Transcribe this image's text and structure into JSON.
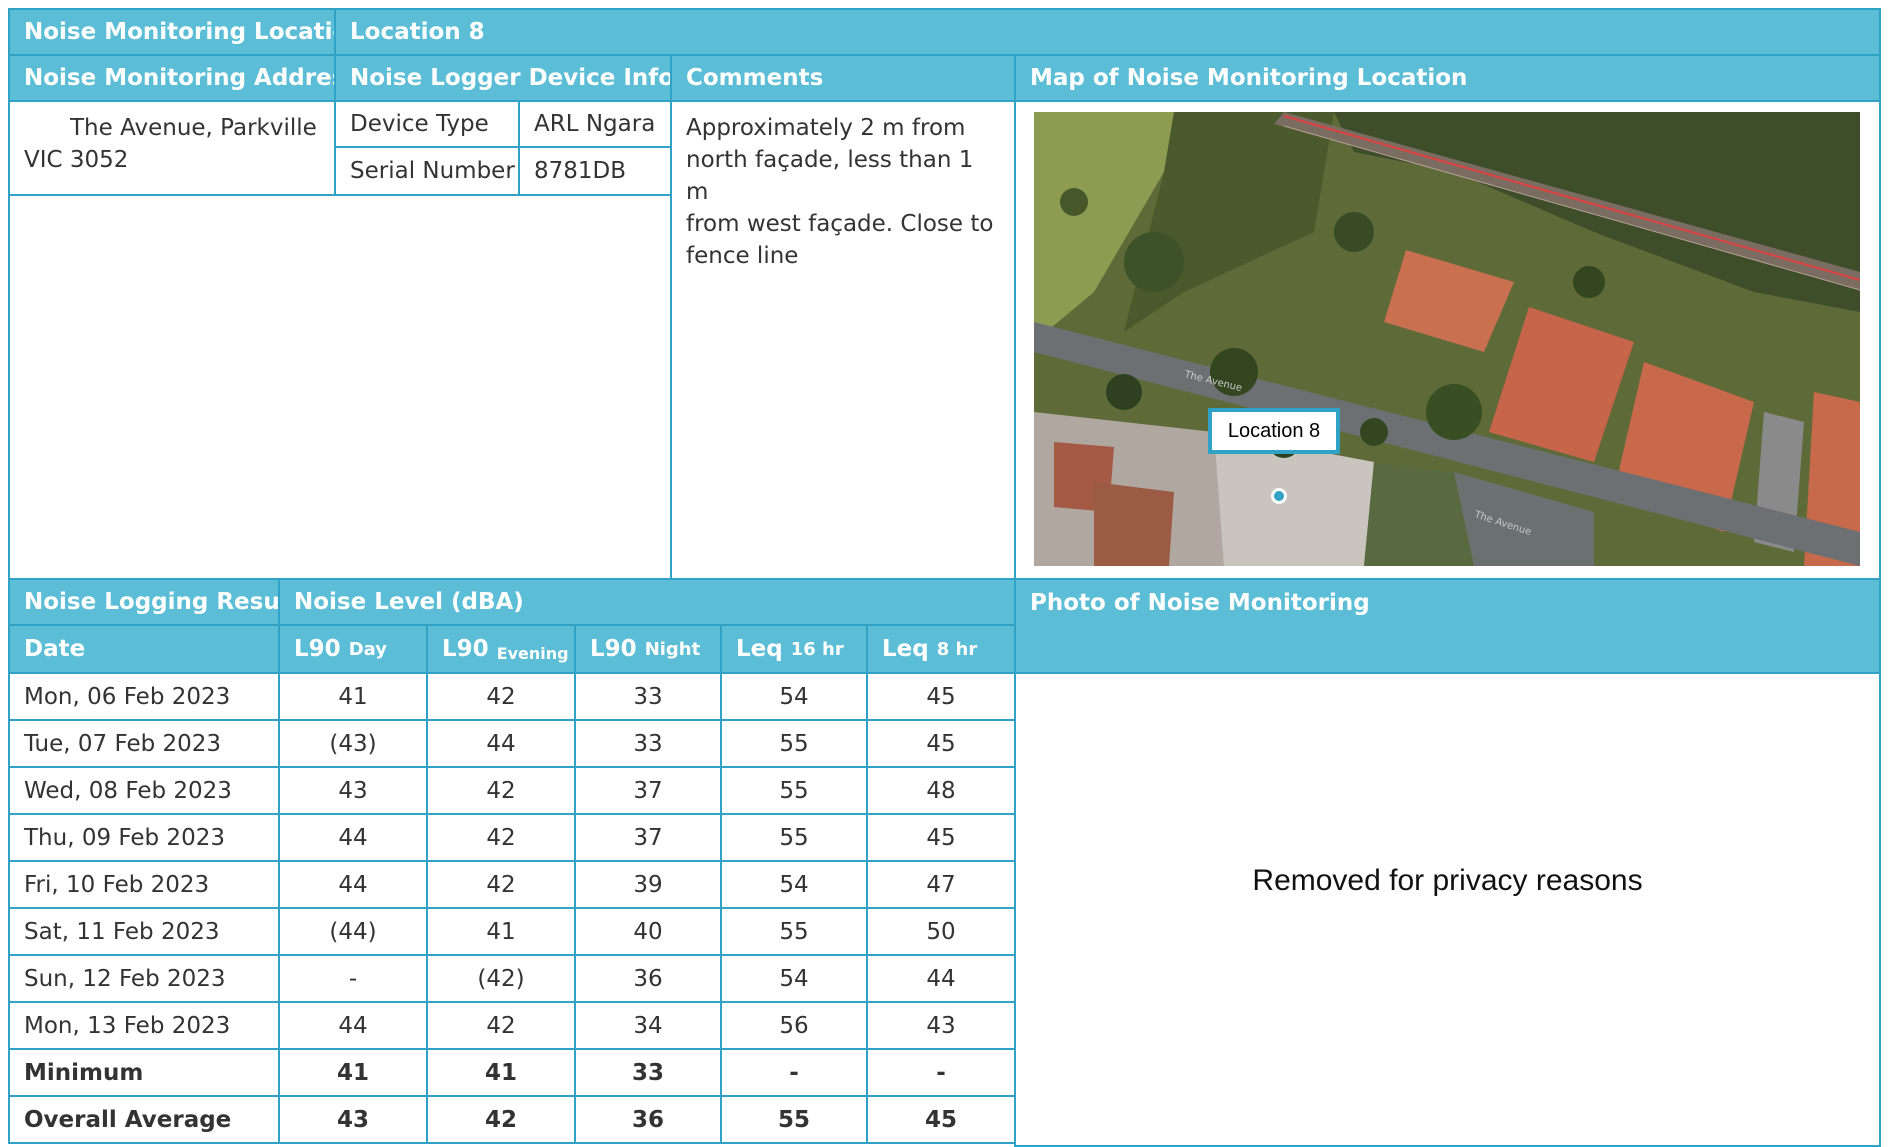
{
  "header": {
    "location_label": "Noise Monitoring Location",
    "location_value": "Location 8",
    "address_label": "Noise Monitoring Address",
    "device_label": "Noise Logger Device Info",
    "comments_label": "Comments",
    "map_label": "Map of Noise Monitoring Location"
  },
  "address": {
    "line1": "The Avenue, Parkville",
    "line2": "VIC 3052"
  },
  "device": {
    "type_label": "Device Type",
    "type_value": "ARL Ngara",
    "serial_label": "Serial Number",
    "serial_value": "8781DB"
  },
  "comments": {
    "line1": "Approximately 2 m from",
    "line2": "north façade, less than 1 m",
    "line3": "from west façade. Close to",
    "line4": "fence line"
  },
  "map": {
    "marker_label": "Location 8",
    "road_labels": [
      "The Avenue",
      "The Avenue"
    ]
  },
  "results": {
    "title": "Noise Logging Results",
    "level_title": "Noise Level (dBA)",
    "photo_title": "Photo of Noise Monitoring",
    "photo_placeholder": "Removed for privacy reasons",
    "columns": {
      "date": "Date",
      "l90_day_main": "L90",
      "l90_day_sub": "Day",
      "l90_eve_main": "L90",
      "l90_eve_sub": "Evening",
      "l90_night_main": "L90",
      "l90_night_sub": "Night",
      "leq16_main": "Leq",
      "leq16_sub": "16 hr",
      "leq8_main": "Leq",
      "leq8_sub": "8 hr"
    },
    "rows": [
      [
        "Mon, 06 Feb 2023",
        "41",
        "42",
        "33",
        "54",
        "45"
      ],
      [
        "Tue, 07 Feb 2023",
        "(43)",
        "44",
        "33",
        "55",
        "45"
      ],
      [
        "Wed, 08 Feb 2023",
        "43",
        "42",
        "37",
        "55",
        "48"
      ],
      [
        "Thu, 09 Feb 2023",
        "44",
        "42",
        "37",
        "55",
        "45"
      ],
      [
        "Fri, 10 Feb 2023",
        "44",
        "42",
        "39",
        "54",
        "47"
      ],
      [
        "Sat, 11 Feb 2023",
        "(44)",
        "41",
        "40",
        "55",
        "50"
      ],
      [
        "Sun, 12 Feb 2023",
        "-",
        "(42)",
        "36",
        "54",
        "44"
      ],
      [
        "Mon, 13 Feb 2023",
        "44",
        "42",
        "34",
        "56",
        "43"
      ],
      [
        "Minimum",
        "41",
        "41",
        "33",
        "-",
        "-"
      ],
      [
        "Overall Average",
        "43",
        "42",
        "36",
        "55",
        "45"
      ]
    ]
  },
  "colors": {
    "header_bg": "#5BBED6",
    "border": "#30A2C6",
    "text": "#333333"
  }
}
